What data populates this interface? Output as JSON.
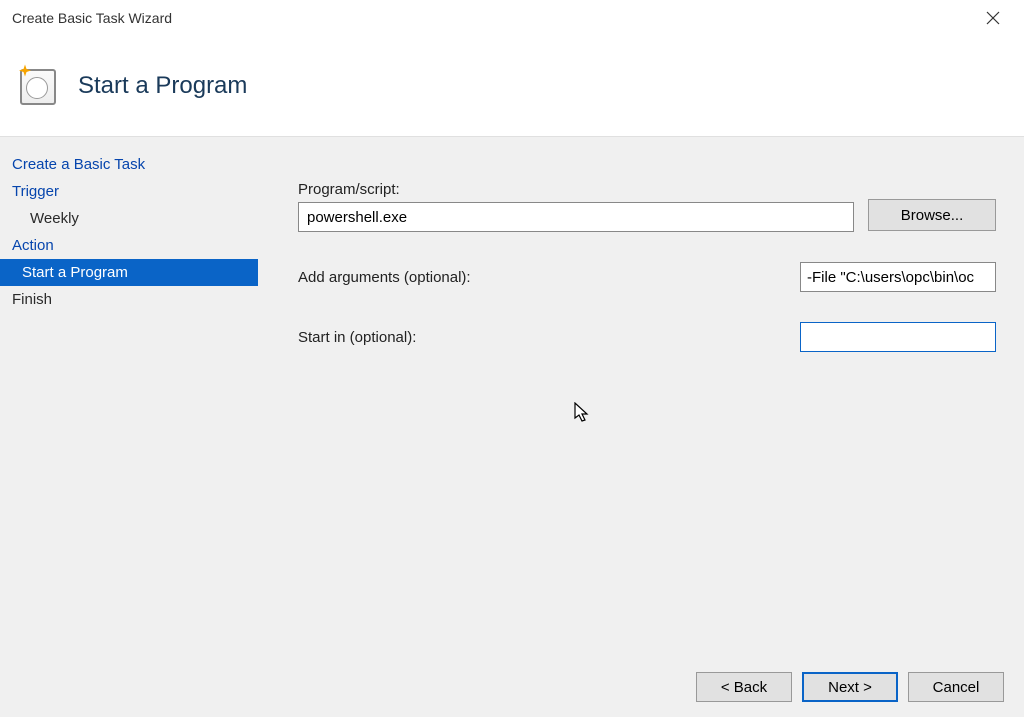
{
  "window": {
    "title": "Create Basic Task Wizard"
  },
  "header": {
    "page_title": "Start a Program"
  },
  "sidebar": {
    "items": [
      {
        "label": "Create a Basic Task",
        "kind": "link",
        "indent": false,
        "active": false
      },
      {
        "label": "Trigger",
        "kind": "link",
        "indent": false,
        "active": false
      },
      {
        "label": "Weekly",
        "kind": "plain",
        "indent": true,
        "active": false
      },
      {
        "label": "Action",
        "kind": "link",
        "indent": false,
        "active": false
      },
      {
        "label": "Start a Program",
        "kind": "plain",
        "indent": true,
        "active": true
      },
      {
        "label": "Finish",
        "kind": "plain",
        "indent": false,
        "active": false
      }
    ]
  },
  "form": {
    "program_label": "Program/script:",
    "program_value": "powershell.exe",
    "browse_label": "Browse...",
    "args_label": "Add arguments (optional):",
    "args_value": "-File \"C:\\users\\opc\\bin\\oc",
    "startin_label": "Start in (optional):",
    "startin_value": ""
  },
  "footer": {
    "back": "< Back",
    "next": "Next >",
    "cancel": "Cancel"
  }
}
